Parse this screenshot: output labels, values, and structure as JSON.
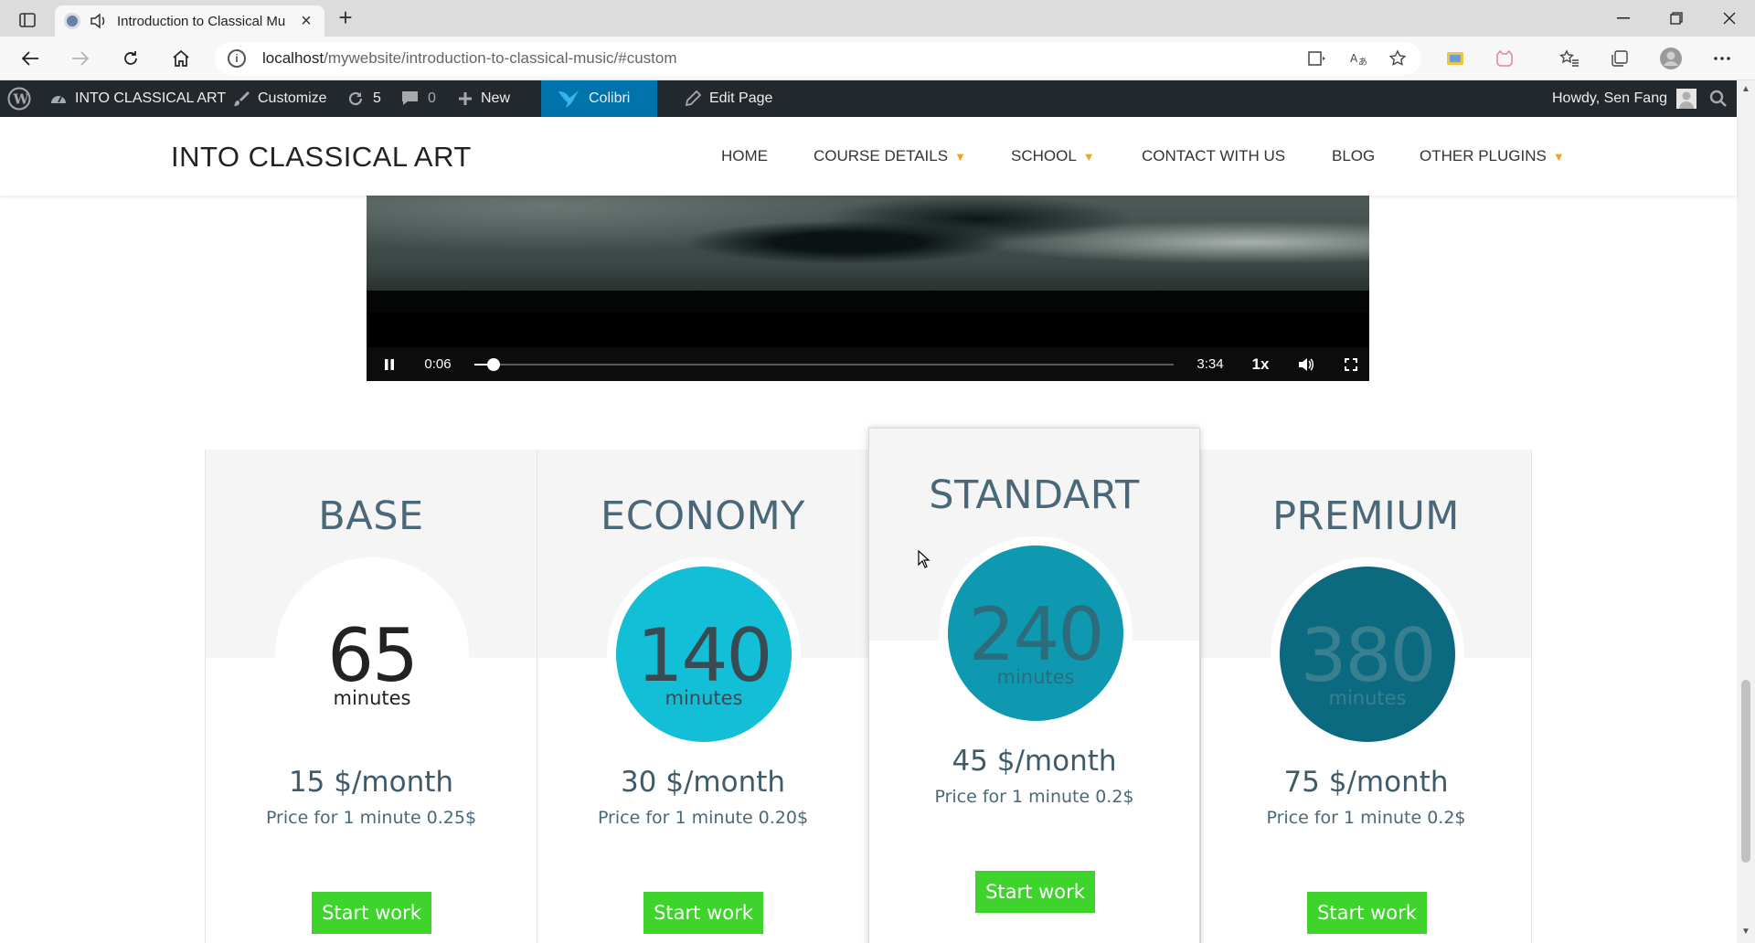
{
  "browser": {
    "tab_title": "Introduction to Classical Mu",
    "url_host": "localhost",
    "url_path": "/mywebsite/introduction-to-classical-music/#custom"
  },
  "adminbar": {
    "site_name": "INTO CLASSICAL ART",
    "customize": "Customize",
    "updates_count": "5",
    "comments_count": "0",
    "new": "New",
    "colibri": "Colibri",
    "edit_page": "Edit Page",
    "howdy": "Howdy, Sen Fang"
  },
  "header": {
    "site_title": "INTO CLASSICAL ART",
    "menu": {
      "home": "HOME",
      "course_details": "COURSE DETAILS",
      "school": "SCHOOL",
      "contact": "CONTACT WITH US",
      "blog": "BLOG",
      "other_plugins": "OTHER PLUGINS"
    }
  },
  "video": {
    "current_time": "0:06",
    "duration": "3:34",
    "speed": "1x",
    "progress_fraction": 0.028,
    "state": "playing"
  },
  "pricing": {
    "plans": [
      {
        "name": "BASE",
        "minutes": "65",
        "unit": "minutes",
        "price": "15 $/month",
        "per_minute": "Price for 1 minute 0.25$",
        "cta": "Start work",
        "circle_color": "#ffffff",
        "num_color": "#222222"
      },
      {
        "name": "ECONOMY",
        "minutes": "140",
        "unit": "minutes",
        "price": "30 $/month",
        "per_minute": "Price for 1 minute 0.20$",
        "cta": "Start work",
        "circle_color": "#13bfd6",
        "num_color": "#3a4a52"
      },
      {
        "name": "STANDART",
        "minutes": "240",
        "unit": "minutes",
        "price": "45 $/month",
        "per_minute": "Price for 1 minute 0.2$",
        "cta": "Start work",
        "circle_color": "#0e99b0",
        "num_color": "#2e6c7c"
      },
      {
        "name": "PREMIUM",
        "minutes": "380",
        "unit": "minutes",
        "price": "75 $/month",
        "per_minute": "Price for 1 minute 0.2$",
        "cta": "Start work",
        "circle_color": "#0c6a80",
        "num_color": "#3a7f90"
      }
    ],
    "featured_index": 2,
    "button_color": "#3fd42c",
    "heading_color": "#4a6878"
  },
  "colors": {
    "adminbar_bg": "#23282d",
    "colibri_bg": "#0073aa",
    "menu_caret": "#f7a21a"
  }
}
